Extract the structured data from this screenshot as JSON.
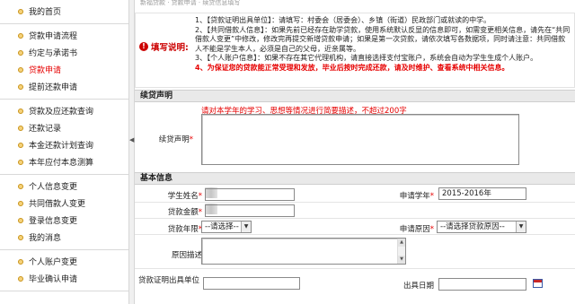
{
  "sidebar": {
    "groups": [
      {
        "items": [
          {
            "label": "我的首页",
            "active": false
          }
        ]
      },
      {
        "items": [
          {
            "label": "贷款申请流程",
            "active": false
          },
          {
            "label": "约定与承诺书",
            "active": false
          },
          {
            "label": "贷款申请",
            "active": true
          },
          {
            "label": "提前还款申请",
            "active": false
          }
        ]
      },
      {
        "items": [
          {
            "label": "贷款及应还款查询",
            "active": false
          },
          {
            "label": "还款记录",
            "active": false
          },
          {
            "label": "本金还款计划查询",
            "active": false
          },
          {
            "label": "本年应付本息测算",
            "active": false
          }
        ]
      },
      {
        "items": [
          {
            "label": "个人信息变更",
            "active": false
          },
          {
            "label": "共同借款人变更",
            "active": false
          },
          {
            "label": "登录信息变更",
            "active": false
          },
          {
            "label": "我的消息",
            "active": false
          }
        ]
      },
      {
        "items": [
          {
            "label": "个人账户变更",
            "active": false
          },
          {
            "label": "毕业确认申请",
            "active": false
          }
        ]
      }
    ]
  },
  "topbar": {
    "text": "新福贷款 · 贷款申请 · 续贷信息填写"
  },
  "notice": {
    "label": "填写说明:",
    "lines": [
      "1、【贷款证明出具单位】：请填写：村委会（居委会）、乡镇（街道）民政部门或就读的中学。",
      "2、【共同借款人信息】：如果先前已经存在助学贷款，使用系统默认反显的信息即可，如需变更相关信息，请先在“共同借款人变更”中修改，修改完再提交新增贷款申请；如果是第一次贷款，请依次填写各数据项，同时请注意：共同借款人不能是学生本人，必须是自己的父母，近亲属等。",
      "3、【个人账户信息】：如果不存在其它代理机构，请直接选择支付宝账户，系统会自动为学生生成个人账户。"
    ],
    "warning": "4、为保证您的贷款能正常受理和发放，毕业后按时完成还款，请及时维护、查看系统中相关信息。"
  },
  "renewal": {
    "title": "续贷声明",
    "hint": "请对本学年的学习、思想等情况进行简要描述，不超过200字",
    "field_label": "续贷声明",
    "required_mark": "*",
    "value": ""
  },
  "basic": {
    "title": "基本信息",
    "student_name_label": "学生姓名",
    "student_name_value": "",
    "academic_year_label": "申请学年",
    "academic_year_value": "2015-2016年",
    "loan_amount_label": "贷款金额",
    "loan_amount_value": "",
    "loan_term_label": "贷款年限",
    "loan_term_value": "--请选择--",
    "reason_label": "申请原因",
    "reason_value": "--请选择贷款原因--",
    "reason_desc_label": "原因描述",
    "reason_desc_value": "",
    "cert_unit_label": "贷款证明出具单位",
    "cert_unit_value": "",
    "issue_date_label": "出具日期",
    "issue_date_value": "",
    "required_mark": "*"
  },
  "icons": {
    "nav_bullet": "bullet-dot-icon",
    "warning": "warning-icon",
    "calendar": "calendar-icon",
    "collapse": "collapse-arrow-icon"
  },
  "colors": {
    "accent_red": "#e60000",
    "bullet": "#f6d27a",
    "section_bg": "#e9e9e9"
  }
}
